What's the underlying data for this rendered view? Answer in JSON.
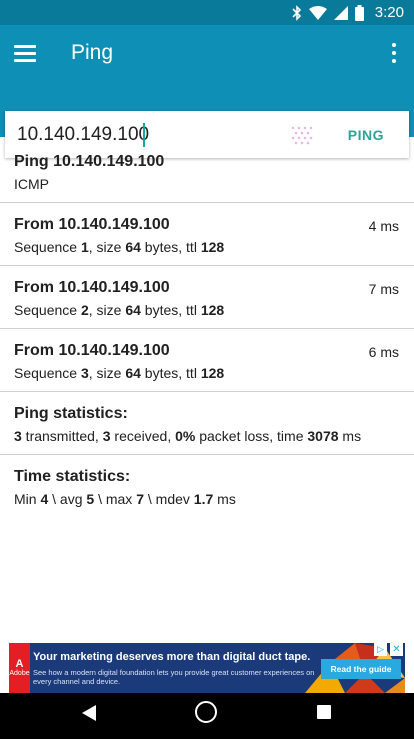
{
  "status_bar": {
    "time": "3:20",
    "icons": [
      "bluetooth-icon",
      "wifi-icon",
      "signal-icon",
      "battery-icon"
    ]
  },
  "app_bar": {
    "title": "Ping",
    "menu_icon": "hamburger-menu-icon",
    "overflow_icon": "more-vert-icon"
  },
  "input": {
    "value": "10.140.149.100",
    "action_label": "PING",
    "loader_icon": "loading-dots-icon"
  },
  "results": {
    "header": {
      "title": "Ping 10.140.149.100",
      "protocol": "ICMP"
    },
    "replies": [
      {
        "title": "From 10.140.149.100",
        "time": "4 ms",
        "seq_label": "Sequence ",
        "seq": "1",
        "size_label": ", size ",
        "size": "64",
        "bytes_label": " bytes, ttl ",
        "ttl": "128"
      },
      {
        "title": "From 10.140.149.100",
        "time": "7 ms",
        "seq_label": "Sequence ",
        "seq": "2",
        "size_label": ", size ",
        "size": "64",
        "bytes_label": " bytes, ttl ",
        "ttl": "128"
      },
      {
        "title": "From 10.140.149.100",
        "time": "6 ms",
        "seq_label": "Sequence ",
        "seq": "3",
        "size_label": ", size ",
        "size": "64",
        "bytes_label": " bytes, ttl ",
        "ttl": "128"
      }
    ],
    "ping_stats": {
      "title": "Ping statistics:",
      "transmitted": "3",
      "transmitted_label": " transmitted, ",
      "received": "3",
      "received_label": " received, ",
      "loss": "0%",
      "loss_label": " packet loss, time ",
      "time": "3078",
      "time_unit": " ms"
    },
    "time_stats": {
      "title": "Time statistics:",
      "min_label": "Min ",
      "min": "4",
      "avg_label": " \\ avg ",
      "avg": "5",
      "max_label": " \\ max ",
      "max": "7",
      "mdev_label": " \\ mdev ",
      "mdev": "1.7",
      "unit": " ms"
    }
  },
  "ad": {
    "brand": "Adobe",
    "headline": "Your marketing deserves more than digital duct tape.",
    "body": "See how a modern digital foundation lets you provide great customer experiences on every channel and device.",
    "cta": "Read the guide",
    "adchoices_icon": "adchoices-icon",
    "close_icon": "close-icon"
  },
  "nav_bar": {
    "back_icon": "back-triangle-icon",
    "home_icon": "home-circle-icon",
    "recent_icon": "recent-apps-square-icon"
  },
  "colors": {
    "status_bar": "#0a7a9a",
    "app_bar": "#0e8fb5",
    "accent": "#2aa598",
    "divider": "#cfcfcf"
  }
}
